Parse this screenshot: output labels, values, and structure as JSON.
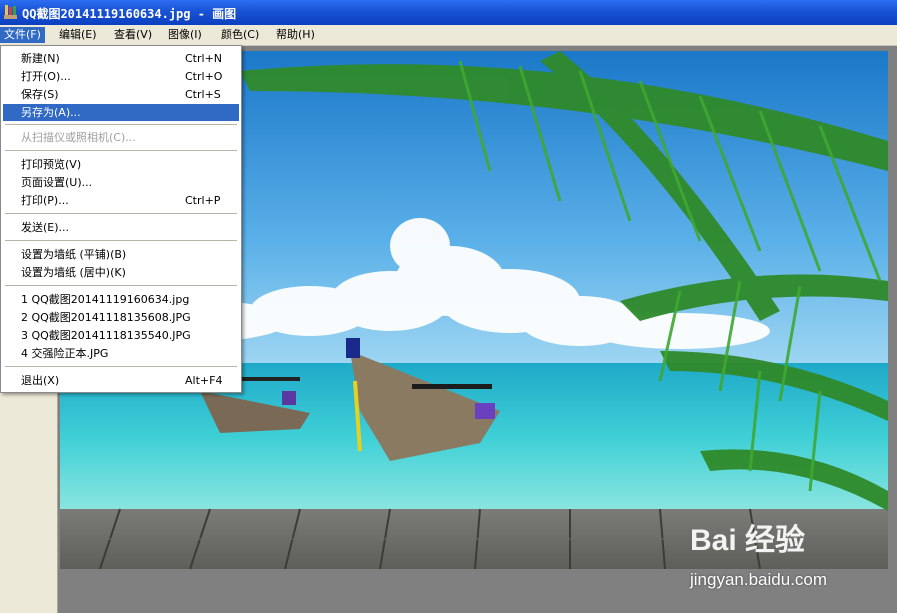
{
  "window": {
    "title": "QQ截图20141119160634.jpg - 画图",
    "app_icon": "paint-app-icon"
  },
  "menubar": {
    "items": [
      {
        "label": "文件(F)"
      },
      {
        "label": "编辑(E)"
      },
      {
        "label": "查看(V)"
      },
      {
        "label": "图像(I)"
      },
      {
        "label": "颜色(C)"
      },
      {
        "label": "帮助(H)"
      }
    ]
  },
  "file_menu": {
    "items": [
      {
        "label": "新建(N)",
        "shortcut": "Ctrl+N"
      },
      {
        "label": "打开(O)...",
        "shortcut": "Ctrl+O"
      },
      {
        "label": "保存(S)",
        "shortcut": "Ctrl+S"
      },
      {
        "label": "另存为(A)...",
        "shortcut": "",
        "selected": true
      },
      {
        "label": "从扫描仪或照相机(C)...",
        "shortcut": "",
        "disabled": true
      },
      {
        "label": "打印预览(V)",
        "shortcut": ""
      },
      {
        "label": "页面设置(U)...",
        "shortcut": ""
      },
      {
        "label": "打印(P)...",
        "shortcut": "Ctrl+P"
      },
      {
        "label": "发送(E)...",
        "shortcut": ""
      },
      {
        "label": "设置为墙纸 (平铺)(B)",
        "shortcut": ""
      },
      {
        "label": "设置为墙纸 (居中)(K)",
        "shortcut": ""
      },
      {
        "label": "1 QQ截图20141119160634.jpg",
        "shortcut": ""
      },
      {
        "label": "2 QQ截图20141118135608.JPG",
        "shortcut": ""
      },
      {
        "label": "3 QQ截图20141118135540.JPG",
        "shortcut": ""
      },
      {
        "label": "4 交强险正本.JPG",
        "shortcut": ""
      },
      {
        "label": "退出(X)",
        "shortcut": "Alt+F4"
      }
    ]
  },
  "watermark": {
    "brand": "Bai 经验",
    "url": "jingyan.baidu.com"
  },
  "colors": {
    "titlebar": "#1a55d6",
    "menu_highlight": "#316ac5",
    "workspace": "#808080"
  }
}
